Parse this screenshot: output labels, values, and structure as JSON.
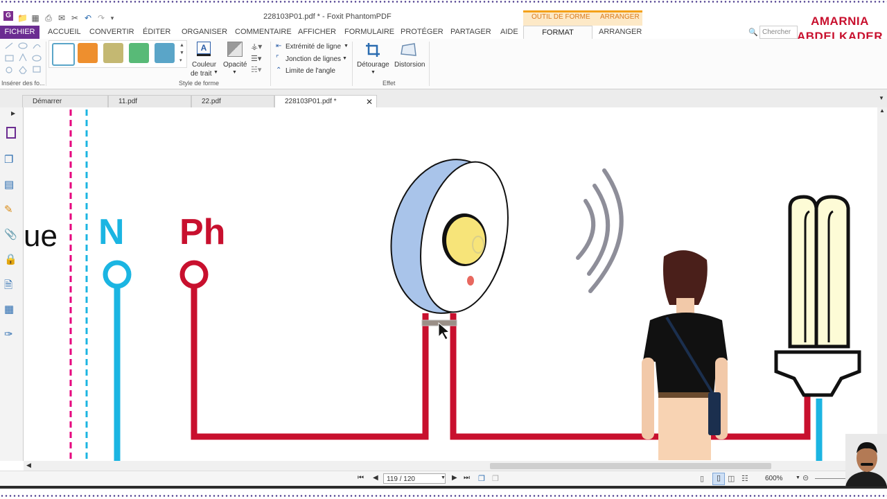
{
  "window": {
    "title": "228103P01.pdf * - Foxit PhantomPDF"
  },
  "context_tabs": {
    "shape_tool": "OUTIL DE FORME",
    "arrange": "ARRANGER"
  },
  "ribbon_tabs": [
    "FICHIER",
    "ACCUEIL",
    "CONVERTIR",
    "ÉDITER",
    "ORGANISER",
    "COMMENTAIRE",
    "AFFICHER",
    "FORMULAIRE",
    "PROTÉGER",
    "PARTAGER",
    "AIDE",
    "FORMAT",
    "ARRANGER"
  ],
  "search": {
    "placeholder": "Chercher"
  },
  "ribbon": {
    "insert_group_label": "Insérer des fo...",
    "style_group_label": "Style de forme",
    "effect_group_label": "Effet",
    "stroke_color_label_1": "Couleur",
    "stroke_color_label_2": "de trait",
    "opacity_label": "Opacité",
    "line_end_label": "Extrémité de ligne",
    "line_join_label": "Jonction de lignes",
    "angle_limit_label": "Limite de l'angle",
    "crop_label": "Détourage",
    "distortion_label": "Distorsion",
    "swatch_colors": [
      "#ffffff",
      "#ee8f2e",
      "#c4b872",
      "#58ba77",
      "#5aa5c8"
    ]
  },
  "doc_tabs": [
    "Démarrer",
    "11.pdf",
    "22.pdf",
    "228103P01.pdf *"
  ],
  "canvas": {
    "partial_text": "ue",
    "neutral_label": "N",
    "phase_label": "Ph",
    "colors": {
      "neutral": "#1bb5e2",
      "phase": "#c8102e",
      "magenta_dash": "#e6007e"
    }
  },
  "statusbar": {
    "page": "119 / 120",
    "zoom": "600%"
  },
  "brand": {
    "line1": "AMARNIA",
    "line2": "ABDELKADER"
  }
}
